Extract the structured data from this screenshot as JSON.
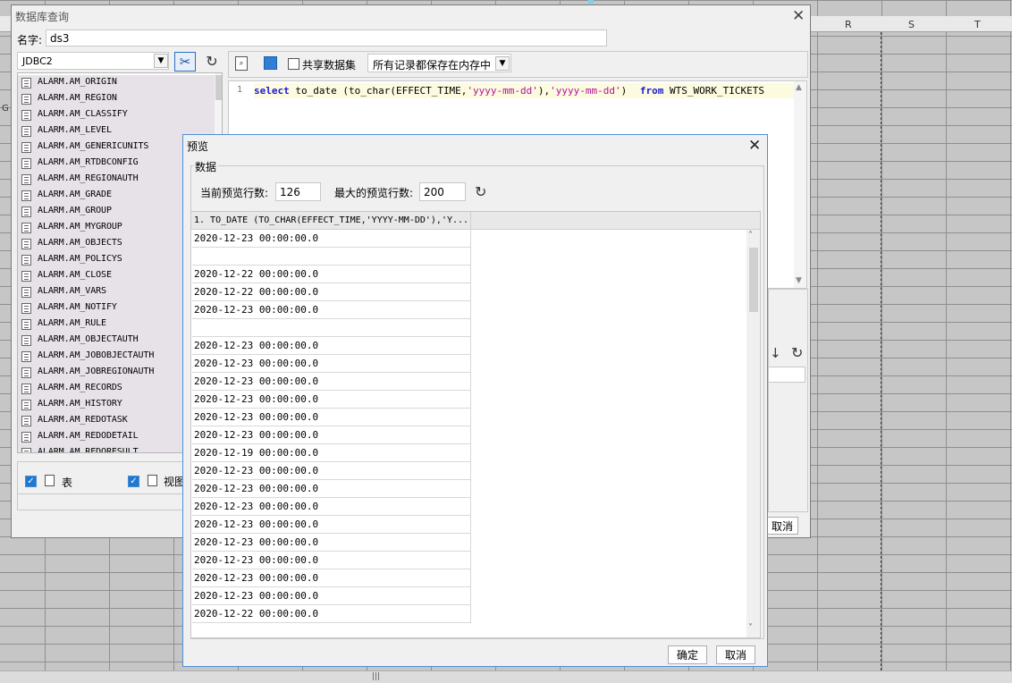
{
  "background_sheet": {
    "columns": [
      "R",
      "S",
      "T"
    ],
    "left_cut_label": "G",
    "scroll_grip": "|||"
  },
  "query_dialog": {
    "title": "数据库查询",
    "name_label": "名字:",
    "name_value": "ds3",
    "connection": "JDBC2",
    "tables": [
      "ALARM.AM_ORIGIN",
      "ALARM.AM_REGION",
      "ALARM.AM_CLASSIFY",
      "ALARM.AM_LEVEL",
      "ALARM.AM_GENERICUNITS",
      "ALARM.AM_RTDBCONFIG",
      "ALARM.AM_REGIONAUTH",
      "ALARM.AM_GRADE",
      "ALARM.AM_GROUP",
      "ALARM.AM_MYGROUP",
      "ALARM.AM_OBJECTS",
      "ALARM.AM_POLICYS",
      "ALARM.AM_CLOSE",
      "ALARM.AM_VARS",
      "ALARM.AM_NOTIFY",
      "ALARM.AM_RULE",
      "ALARM.AM_OBJECTAUTH",
      "ALARM.AM_JOBOBJECTAUTH",
      "ALARM.AM_JOBREGIONAUTH",
      "ALARM.AM_RECORDS",
      "ALARM.AM_HISTORY",
      "ALARM.AM_REDOTASK",
      "ALARM.AM_REDODETAIL",
      "ALARM.AM_REDORESULT"
    ],
    "table_checkbox_label": "表",
    "view_checkbox_label": "视图",
    "share_dataset_label": "共享数据集",
    "memory_option": "所有记录都保存在内存中",
    "sql_line_number": "1",
    "sql": {
      "kw_select": "select",
      "fn_open": "to_date (to_char(EFFECT_TIME,",
      "str1": "'yyyy-mm-dd'",
      "mid": "),",
      "str2": "'yyyy-mm-dd'",
      "close": ")",
      "kw_from": "from",
      "tail": "WTS_WORK_TICKETS"
    },
    "cancel_label": "取消"
  },
  "preview_dialog": {
    "title": "预览",
    "group_label": "数据",
    "current_rows_label": "当前预览行数:",
    "current_rows_value": "126",
    "max_rows_label": "最大的预览行数:",
    "max_rows_value": "200",
    "column_header": "1. TO_DATE (TO_CHAR(EFFECT_TIME,'YYYY-MM-DD'),'Y...",
    "rows": [
      "2020-12-23 00:00:00.0",
      "",
      "2020-12-22 00:00:00.0",
      "2020-12-22 00:00:00.0",
      "2020-12-23 00:00:00.0",
      "",
      "2020-12-23 00:00:00.0",
      "2020-12-23 00:00:00.0",
      "2020-12-23 00:00:00.0",
      "2020-12-23 00:00:00.0",
      "2020-12-23 00:00:00.0",
      "2020-12-23 00:00:00.0",
      "2020-12-19 00:00:00.0",
      "2020-12-23 00:00:00.0",
      "2020-12-23 00:00:00.0",
      "2020-12-23 00:00:00.0",
      "2020-12-23 00:00:00.0",
      "2020-12-23 00:00:00.0",
      "2020-12-23 00:00:00.0",
      "2020-12-23 00:00:00.0",
      "2020-12-23 00:00:00.0",
      "2020-12-22 00:00:00.0"
    ],
    "ok_label": "确定",
    "cancel_label": "取消"
  }
}
